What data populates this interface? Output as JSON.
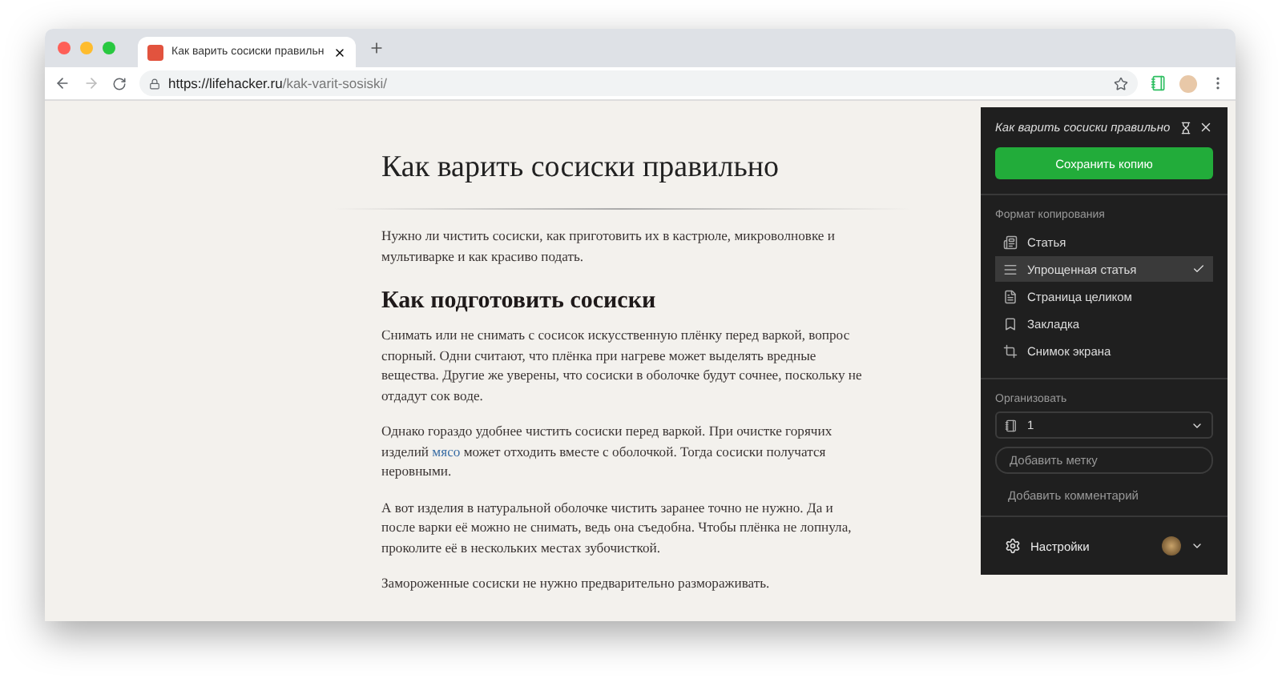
{
  "browser": {
    "tab": {
      "title": "Как варить сосиски правильн"
    },
    "address": {
      "scheme_host": "https://lifehacker.ru",
      "path": "/kak-varit-sosiski/"
    }
  },
  "article": {
    "title": "Как варить сосиски правильно",
    "lead": "Нужно ли чистить сосиски, как приготовить их в кастрюле, микроволновке и мультиварке и как красиво подать.",
    "heading": "Как подготовить сосиски",
    "paragraphs": [
      {
        "before": "Снимать или не снимать с сосисок искусственную плёнку перед варкой, вопрос спорный. Одни считают, что плёнка при нагреве может выделять вредные вещества. Другие же уверены, что сосиски в оболочке будут сочнее, поскольку не отдадут сок воде."
      },
      {
        "before": "Однако гораздо удобнее чистить сосиски перед варкой. При очистке горячих изделий ",
        "link": "мясо",
        "after": " может отходить вместе с оболочкой. Тогда сосиски получатся неровными."
      },
      {
        "before": "А вот изделия в натуральной оболочке чистить заранее точно не нужно. Да и после варки её можно не снимать, ведь она съедобна. Чтобы плёнка не лопнула, проколите её в нескольких местах зубочисткой."
      },
      {
        "before": "Замороженные сосиски не нужно предварительно размораживать."
      }
    ]
  },
  "clipper": {
    "title": "Как варить сосиски правильно",
    "save_button": "Сохранить копию",
    "format_label": "Формат копирования",
    "formats": [
      {
        "kind": "article",
        "label": "Статья",
        "selected": false
      },
      {
        "kind": "simplified",
        "label": "Упрощенная статья",
        "selected": true
      },
      {
        "kind": "page",
        "label": "Страница целиком",
        "selected": false
      },
      {
        "kind": "bookmark",
        "label": "Закладка",
        "selected": false
      },
      {
        "kind": "screenshot",
        "label": "Снимок экрана",
        "selected": false
      }
    ],
    "organize_label": "Организовать",
    "notebook": "1",
    "tag": {
      "placeholder": "Добавить метку"
    },
    "comment": {
      "placeholder": "Добавить комментарий"
    },
    "settings": "Настройки"
  }
}
